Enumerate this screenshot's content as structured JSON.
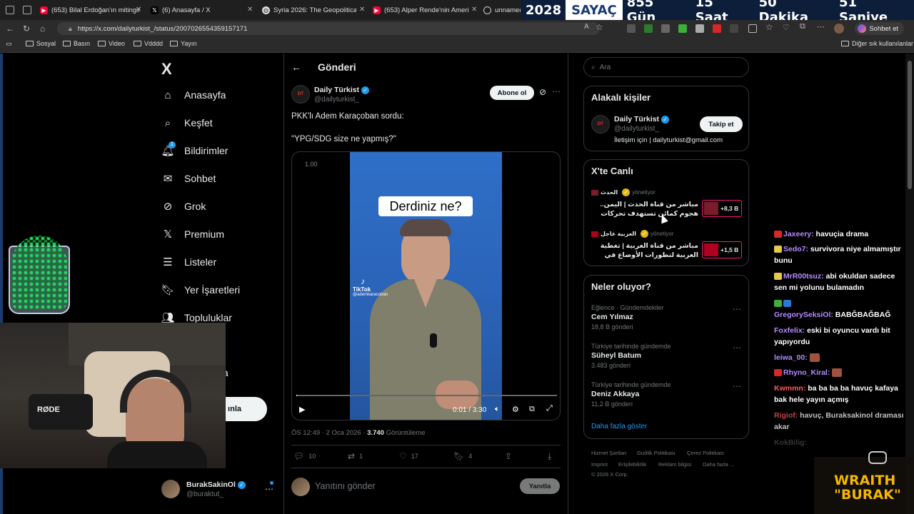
{
  "browser": {
    "tabs": [
      {
        "label": "(653) Bilal Erdoğan'ın mitingine k",
        "icon": "youtube-icon"
      },
      {
        "label": "(6) Anasayfa / X",
        "icon": "x-icon"
      },
      {
        "label": "Syria 2026: The Geopolitical Map",
        "icon": "globe-icon"
      },
      {
        "label": "(653) Alper Rende'nin Amerikan İ",
        "icon": "youtube-icon"
      },
      {
        "label": "unnamed (",
        "icon": "globe-icon"
      }
    ],
    "url": "https://x.com/dailyturkist_/status/2007026554359157171",
    "sohbet_label": "Sohbet et",
    "bookmarks": [
      "Sosyal",
      "Basın",
      "Video",
      "Vdddd",
      "Yayın"
    ],
    "other_bookmarks": "Diğer sık kullanılanlar"
  },
  "countdown": {
    "year": "2028",
    "label": "SAYAÇ",
    "days": "855 Gün",
    "hours": "15 Saat",
    "minutes": "50 Dakika",
    "seconds": "51 Saniye"
  },
  "sidebar": {
    "logo": "X",
    "items": [
      {
        "label": "Anasayfa",
        "icon": "home-icon"
      },
      {
        "label": "Keşfet",
        "icon": "search-icon"
      },
      {
        "label": "Bildirimler",
        "icon": "bell-icon",
        "badge": "1"
      },
      {
        "label": "Sohbet",
        "icon": "mail-icon"
      },
      {
        "label": "Grok",
        "icon": "grok-icon"
      },
      {
        "label": "Premium",
        "icon": "x-icon"
      },
      {
        "label": "Listeler",
        "icon": "list-icon"
      },
      {
        "label": "Yer İşaretleri",
        "icon": "bookmark-icon"
      },
      {
        "label": "Topluluklar",
        "icon": "people-icon"
      }
    ],
    "partial_label": "a",
    "post_button": "ınla",
    "account": {
      "name": "BurakSakinOl",
      "handle": "@buraktut_"
    }
  },
  "post": {
    "header_title": "Gönderi",
    "author_name": "Daily Türkist",
    "author_handle": "@dailyturkist_",
    "follow_button": "Abone ol",
    "text_line1": "PKK'lı Adem Karaçoban sordu:",
    "text_line2": "\"YPG/SDG size ne yapmış?\"",
    "video": {
      "speed": "1.00",
      "caption": "Derdiniz ne?",
      "watermark": "TikTok",
      "watermark_handle": "@ademkaracoban",
      "time": "0:01 / 3:30"
    },
    "meta_time": "ÖS 12:49 · 2 Oca 2026 · ",
    "views_count": "3.740",
    "views_label": " Görüntüleme",
    "stats": {
      "replies": "10",
      "reposts": "1",
      "likes": "17",
      "bookmarks": "4"
    },
    "reply_placeholder": "Yanıtını gönder",
    "reply_button": "Yanıtla"
  },
  "right": {
    "search_placeholder": "Ara",
    "related_title": "Alakalı kişiler",
    "related_name": "Daily Türkist",
    "related_handle": "@dailyturkist_",
    "related_bio": "İletişim için | dailyturkist@gmail.com",
    "follow_button": "Takip et",
    "live_title": "X'te Canlı",
    "live": [
      {
        "host": "الحدث",
        "status": "yönetiyor",
        "title": "مباشر من قناة الحدث | اليمن.. هجوم كمائن تستهدف تحركات قوات درع",
        "count": "+8,3 B",
        "thumb_color": "#7a1c2c"
      },
      {
        "host": "العربية عاجل",
        "status": "yönetiyor",
        "title": "مباشر من قناة العربية | تغطية العربية لتطورات الأوضاع في اليمن",
        "count": "+1,5 B",
        "thumb_color": "#b00020"
      }
    ],
    "trends_title": "Neler oluyor?",
    "trends": [
      {
        "context": "Eğlence · Gündemdekiler",
        "title": "Cem Yılmaz",
        "count": "18,8 B gönderi"
      },
      {
        "context": "Türkiye tarihinde gündemde",
        "title": "Süheyl Batum",
        "count": "3.483 gönderi"
      },
      {
        "context": "Türkiye tarihinde gündemde",
        "title": "Deniz Akkaya",
        "count": "11,2 B gönderi"
      }
    ],
    "show_more": "Daha fazla göster",
    "footer": {
      "l1": "Hizmet Şartları",
      "l2": "Gizlilik Politikası",
      "l3": "Çerez Politikası",
      "l4": "Imprint",
      "l5": "Erişilebilirlik",
      "l6": "Reklam bilgisi",
      "l7": "Daha fazla ...",
      "copyright": "© 2026 X Corp."
    }
  },
  "stream_chat": [
    {
      "user": "Jaxeery:",
      "msg": " havuçia drama",
      "color": "#b48cff"
    },
    {
      "user": "Sedo7:",
      "msg": " survivora niye almamıştır bunu",
      "color": "#b48cff"
    },
    {
      "user": "MrR00tsuz:",
      "msg": " abi okuldan sadece sen mi yolunu bulamadın",
      "color": "#b48cff"
    },
    {
      "user": "GregorySeksiOl:",
      "msg": " BABĞBAĞBAĞ",
      "color": "#b48cff"
    },
    {
      "user": "Foxfelix:",
      "msg": " eski bi oyuncu vardı bit yapıyordu",
      "color": "#b48cff"
    },
    {
      "user": "leiwa_00:",
      "msg": "",
      "color": "#b48cff"
    },
    {
      "user": "Rhyno_Kiral:",
      "msg": "",
      "color": "#b48cff"
    },
    {
      "user": "Kwmmn:",
      "msg": " ba ba ba ba havuç kafaya bak hele yayın açmış",
      "color": "#ff5a5a"
    },
    {
      "user": "Rigiof:",
      "msg": " havuç, Buraksakinol draması akar",
      "color": "#ff5a5a"
    },
    {
      "user": "KokBilig:",
      "msg": "",
      "color": "#999999"
    }
  ],
  "overlay": {
    "brand_line1": "WRAITH",
    "brand_line2": "\"BURAK\"",
    "mic_brand": "RØDE"
  }
}
